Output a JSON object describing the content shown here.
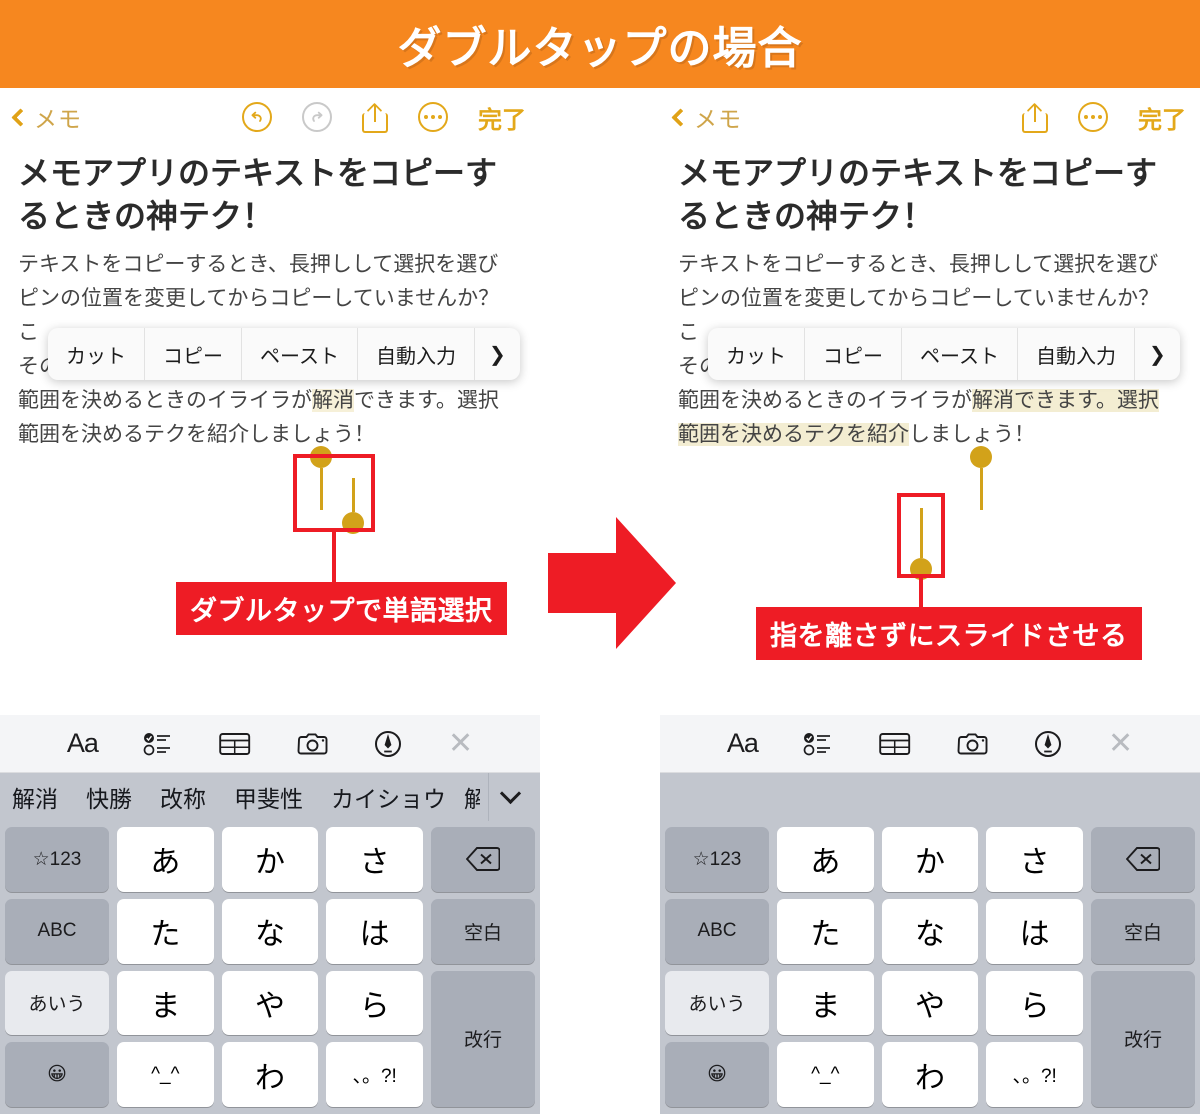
{
  "banner": {
    "title": "ダブルタップの場合",
    "bg_color": "#f6871f",
    "text_color": "#ffffff"
  },
  "colors": {
    "accent_gold": "#e3a81a",
    "annotation_red": "#ee1c25",
    "selection_yellow": "#f6f0d8",
    "keyboard_bg": "#c2c6ce"
  },
  "panels": [
    {
      "id": "left",
      "navbar": {
        "back_label": "メモ",
        "back_icon": "chevron-left-icon",
        "undo_icon": "undo-icon",
        "undo_enabled": true,
        "redo_icon": "redo-icon",
        "redo_enabled": false,
        "share_icon": "share-icon",
        "more_icon": "more-dots-icon",
        "done_label": "完了"
      },
      "note": {
        "title": "メモアプリのテキストをコピーするときの神テク！",
        "body_lines": [
          "テキストをコピーするとき、長押しして選択を選び",
          "ピンの位置を変更してからコピーしていませんか？",
          "こ",
          "そのような時に、果にこのアプリを使うことで、選択",
          "範囲を決めるときのイライラが解消できます。選択",
          "範囲を決めるテクを紹介しましょう！"
        ],
        "selected_text": "解消"
      },
      "context_menu": {
        "items": [
          "カット",
          "コピー",
          "ペースト",
          "自動入力"
        ],
        "more_icon": "chevron-right-icon"
      },
      "annotation": {
        "label": "ダブルタップで単語選択"
      }
    },
    {
      "id": "right",
      "navbar": {
        "back_label": "メモ",
        "back_icon": "chevron-left-icon",
        "share_icon": "share-icon",
        "more_icon": "more-dots-icon",
        "done_label": "完了"
      },
      "note": {
        "title": "メモアプリのテキストをコピーするときの神テク！",
        "body_lines": [
          "テキストをコピーするとき、長押しして選択を選び",
          "ピンの位置を変更してからコピーしていませんか？",
          "こ",
          "そのような時に、果にこのアプリを使うことで、選択",
          "範囲を決めるときのイライラが解消できます。選択",
          "範囲を決めるテクを紹介しましょう！"
        ],
        "selected_text": "解消できます。選択範囲を決めるテクを紹介"
      },
      "context_menu": {
        "items": [
          "カット",
          "コピー",
          "ペースト",
          "自動入力"
        ],
        "more_icon": "chevron-right-icon"
      },
      "annotation": {
        "label": "指を離さずにスライドさせる"
      }
    }
  ],
  "flow_arrow": {
    "icon": "right-arrow-icon",
    "color": "#ee1c25"
  },
  "keyboards": [
    {
      "id": "left",
      "toolbar": [
        "text-format-icon",
        "checklist-icon",
        "table-icon",
        "camera-icon",
        "markup-pen-icon",
        "close-icon"
      ],
      "suggestions": [
        "解消",
        "快勝",
        "改称",
        "甲斐性",
        "カイショウ",
        "解"
      ],
      "suggestions_expand_icon": "chevron-down-icon",
      "keys": [
        "☆123",
        "あ",
        "か",
        "さ",
        "delete-icon",
        "ABC",
        "た",
        "な",
        "は",
        "空白",
        "あいう",
        "ま",
        "や",
        "ら",
        "改行",
        "emoji-icon",
        "^_^",
        "わ",
        "、。?!"
      ]
    },
    {
      "id": "right",
      "toolbar": [
        "text-format-icon",
        "checklist-icon",
        "table-icon",
        "camera-icon",
        "markup-pen-icon",
        "close-icon"
      ],
      "suggestions": [],
      "suggestions_expand_icon": null,
      "keys": [
        "☆123",
        "あ",
        "か",
        "さ",
        "delete-icon",
        "ABC",
        "た",
        "な",
        "は",
        "空白",
        "あいう",
        "ま",
        "や",
        "ら",
        "改行",
        "emoji-icon",
        "^_^",
        "わ",
        "、。?!"
      ]
    }
  ],
  "key_labels": {
    "num": "☆123",
    "abc": "ABC",
    "kana": "あいう",
    "a": "あ",
    "ka": "か",
    "sa": "さ",
    "ta": "た",
    "na": "な",
    "ha": "は",
    "ma": "ま",
    "ya": "や",
    "ra": "ら",
    "kao": "^_^",
    "wa": "わ",
    "punct": "、。?!",
    "space": "空白",
    "enter": "改行"
  }
}
